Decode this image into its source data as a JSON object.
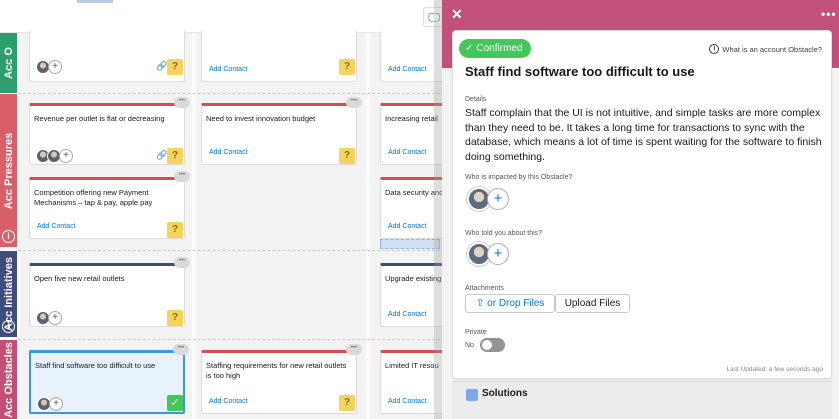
{
  "toolbar": {
    "screen_icon": "screen-icon",
    "screen_glyph": "🖵"
  },
  "lanes": [
    {
      "label": "Acc O",
      "color": "#2f9e6e"
    },
    {
      "label": "Acc Pressures",
      "color": "#d95f6b"
    },
    {
      "label": "Acc Initiatives",
      "color": "#3f4d7c"
    },
    {
      "label": "Acc Obstacles",
      "color": "#c44f76"
    }
  ],
  "cards": {
    "add_contact": "Add Contact",
    "qmark": "?",
    "check": "✓",
    "dots": "•••",
    "plus": "+",
    "clip": "🔗",
    "pressure_1": "Revenue per outlet is flat or decreasing",
    "pressure_2": "Need to invest innovation budget",
    "pressure_3": "Increasing retail",
    "pressure_4": "Competition offering new Payment Mechanisms – tap & pay, apple pay",
    "pressure_5": "Data security and",
    "initiative_1": "Open five new retail outlets",
    "initiative_2": "Upgrade existing",
    "obstacle_1": "Staff find software too difficult to use",
    "obstacle_2": "Staffing requirements for new retail outlets is too high",
    "obstacle_3": "Limited IT resou"
  },
  "panel": {
    "close_glyph": "✕",
    "more_glyph": "•••",
    "status": "Confirmed",
    "status_glyph": "✓",
    "help_link": "What is an account Obstacle?",
    "help_glyph": "i",
    "title": "Staff find software too difficult to use",
    "details_label": "Details",
    "details": "Staff complain that the UI is not intuitive, and simple tasks are more complex than they need to be. It takes a long time for transactions to sync with the database, which means a lot of time is spent waiting for the software to finish doing something.",
    "impacted_label": "Who is impacted by this Obstacle?",
    "told_label": "Who told you about this?",
    "plus": "+",
    "attachments_label": "Attachments",
    "drop_files": "or Drop Files",
    "upload_glyph": "⇧",
    "upload_files": "Upload Files",
    "private_label": "Private",
    "private_value": "No",
    "last_updated": "Last Updated: a few seconds ago",
    "solutions": "Solutions",
    "accent_color": "#c1507a"
  }
}
